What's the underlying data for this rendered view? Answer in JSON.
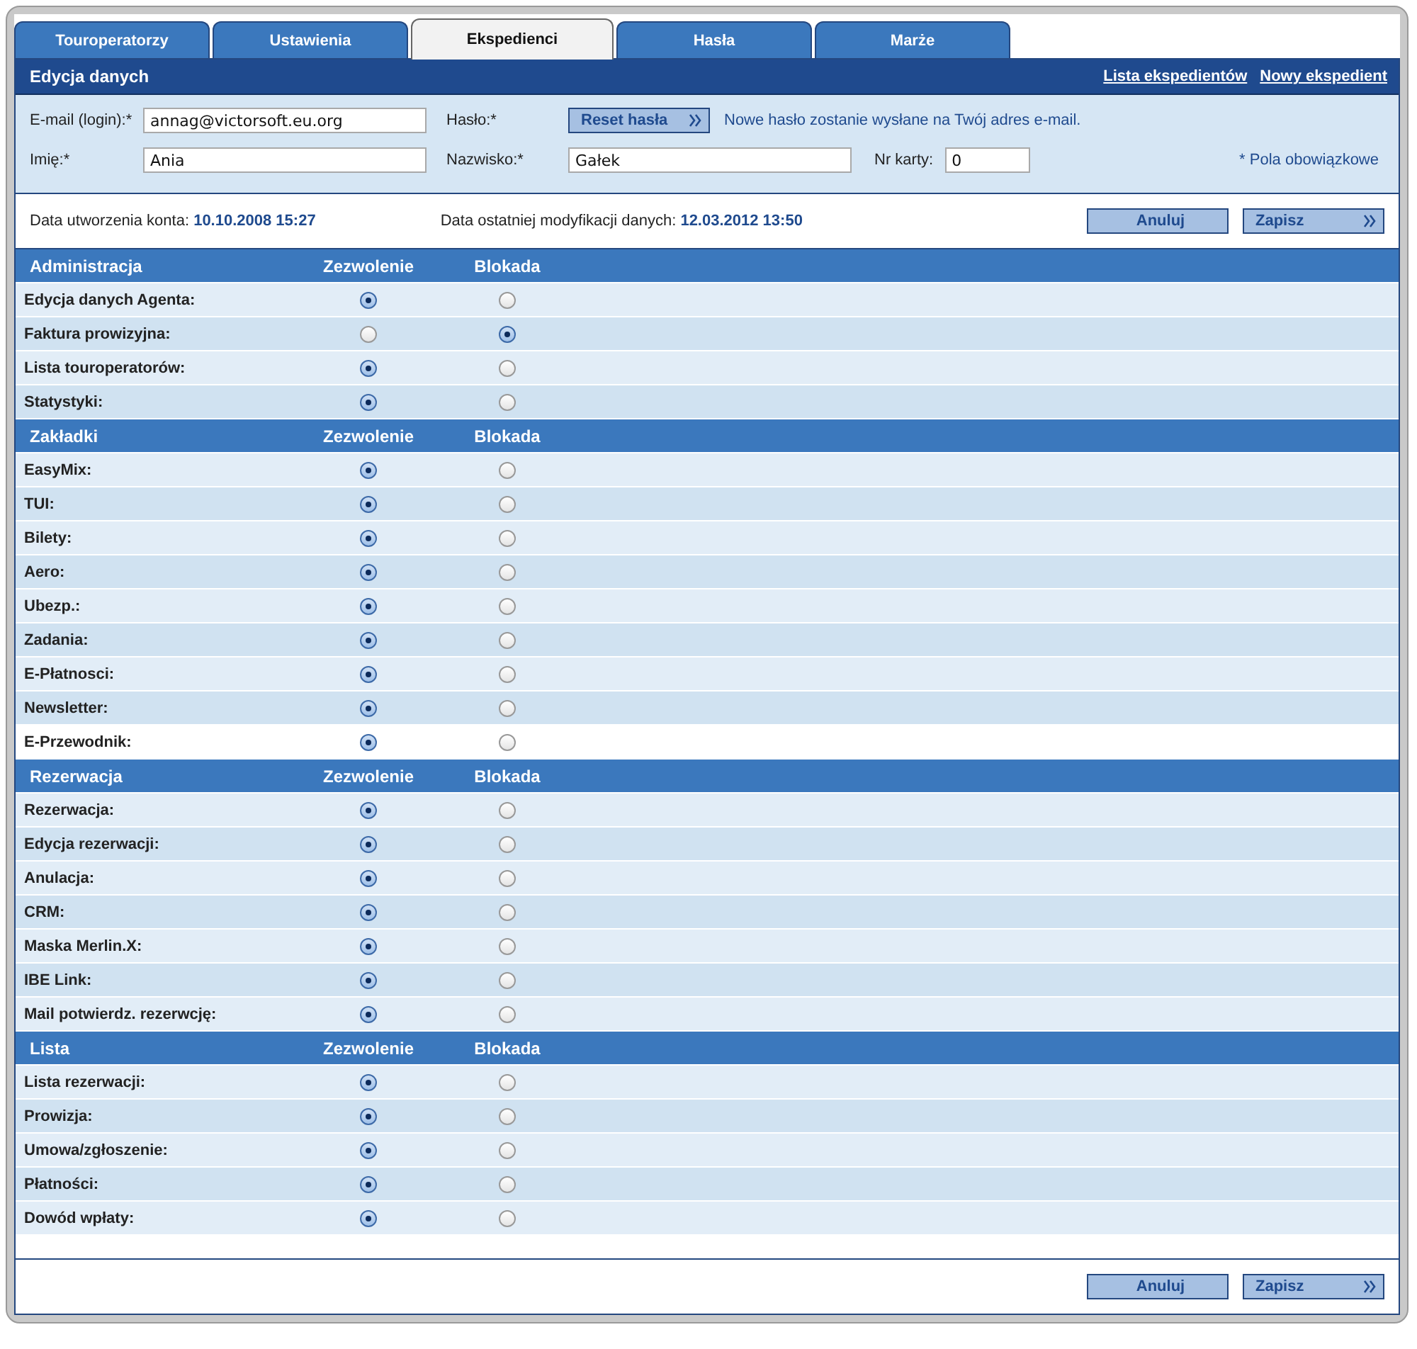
{
  "tabs": [
    {
      "label": "Touroperatorzy",
      "selected": false
    },
    {
      "label": "Ustawienia",
      "selected": false
    },
    {
      "label": "Ekspedienci",
      "selected": true
    },
    {
      "label": "Hasła",
      "selected": false
    },
    {
      "label": "Marże",
      "selected": false
    }
  ],
  "header": {
    "title": "Edycja danych",
    "links": [
      "Lista ekspedientów",
      "Nowy ekspedient"
    ]
  },
  "form": {
    "email_label": "E-mail (login):*",
    "email": "annag@victorsoft.eu.org",
    "password_label": "Hasło:*",
    "reset_button": "Reset hasła",
    "reset_note": "Nowe hasło zostanie wysłane na Twój adres e-mail.",
    "first_name_label": "Imię:*",
    "first_name": "Ania",
    "last_name_label": "Nazwisko:*",
    "last_name": "Gałek",
    "card_label": "Nr karty:",
    "card": "0",
    "required_note": "* Pola obowiązkowe"
  },
  "dates": {
    "created_label": "Data utworzenia konta:",
    "created": "10.10.2008 15:27",
    "modified_label": "Data ostatniej modyfikacji danych:",
    "modified": "12.03.2012 13:50"
  },
  "top_buttons": [
    "Anuluj",
    "Zapisz"
  ],
  "bottom_buttons": [
    "Anuluj",
    "Zapisz"
  ],
  "sections": [
    {
      "title": "Administracja",
      "allow_heading": "Zezwolenie",
      "block_heading": "Blokada",
      "items": [
        {
          "label": "Edycja danych Agenta:",
          "allowed": true,
          "highlighted": false
        },
        {
          "label": "Faktura prowizyjna:",
          "allowed": false,
          "highlighted": false
        },
        {
          "label": "Lista touroperatorów:",
          "allowed": true,
          "highlighted": false
        },
        {
          "label": "Statystyki:",
          "allowed": true,
          "highlighted": false
        }
      ]
    },
    {
      "title": "Zakładki",
      "allow_heading": "Zezwolenie",
      "block_heading": "Blokada",
      "items": [
        {
          "label": "EasyMix:",
          "allowed": true,
          "highlighted": false
        },
        {
          "label": "TUI:",
          "allowed": true,
          "highlighted": false
        },
        {
          "label": "Bilety:",
          "allowed": true,
          "highlighted": false
        },
        {
          "label": "Aero:",
          "allowed": true,
          "highlighted": false
        },
        {
          "label": "Ubezp.:",
          "allowed": true,
          "highlighted": false
        },
        {
          "label": "Zadania:",
          "allowed": true,
          "highlighted": false
        },
        {
          "label": "E-Płatnosci:",
          "allowed": true,
          "highlighted": false
        },
        {
          "label": "Newsletter:",
          "allowed": true,
          "highlighted": false
        },
        {
          "label": "E-Przewodnik:",
          "allowed": true,
          "highlighted": true
        }
      ]
    },
    {
      "title": "Rezerwacja",
      "allow_heading": "Zezwolenie",
      "block_heading": "Blokada",
      "items": [
        {
          "label": "Rezerwacja:",
          "allowed": true,
          "highlighted": false
        },
        {
          "label": "Edycja rezerwacji:",
          "allowed": true,
          "highlighted": false
        },
        {
          "label": "Anulacja:",
          "allowed": true,
          "highlighted": false
        },
        {
          "label": "CRM:",
          "allowed": true,
          "highlighted": false
        },
        {
          "label": "Maska Merlin.X:",
          "allowed": true,
          "highlighted": false
        },
        {
          "label": "IBE Link:",
          "allowed": true,
          "highlighted": false
        },
        {
          "label": "Mail potwierdz. rezerwcję:",
          "allowed": true,
          "highlighted": false
        }
      ]
    },
    {
      "title": "Lista",
      "allow_heading": "Zezwolenie",
      "block_heading": "Blokada",
      "items": [
        {
          "label": "Lista rezerwacji:",
          "allowed": true,
          "highlighted": false
        },
        {
          "label": "Prowizja:",
          "allowed": true,
          "highlighted": false
        },
        {
          "label": "Umowa/zgłoszenie:",
          "allowed": true,
          "highlighted": false
        },
        {
          "label": "Płatności:",
          "allowed": true,
          "highlighted": false
        },
        {
          "label": "Dowód wpłaty:",
          "allowed": true,
          "highlighted": false
        }
      ]
    }
  ]
}
